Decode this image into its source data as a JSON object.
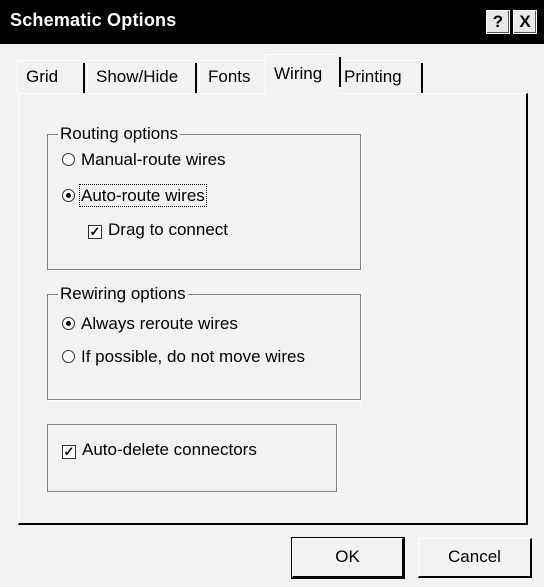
{
  "window": {
    "title": "Schematic Options",
    "help_label": "?",
    "close_label": "X"
  },
  "tabs": [
    {
      "label": "Grid",
      "active": false
    },
    {
      "label": "Show/Hide",
      "active": false
    },
    {
      "label": "Fonts",
      "active": false
    },
    {
      "label": "Wiring",
      "active": true
    },
    {
      "label": "Printing",
      "active": false
    }
  ],
  "routing": {
    "title": "Routing options",
    "manual_label": "Manual-route wires",
    "auto_label": "Auto-route wires",
    "drag_label": "Drag to connect",
    "selected": "auto",
    "drag_checked": true
  },
  "rewiring": {
    "title": "Rewiring options",
    "always_label": "Always reroute wires",
    "ifpossible_label": "If possible, do not move wires",
    "selected": "always"
  },
  "autodelete": {
    "label": "Auto-delete connectors",
    "checked": true
  },
  "buttons": {
    "ok": "OK",
    "cancel": "Cancel"
  }
}
